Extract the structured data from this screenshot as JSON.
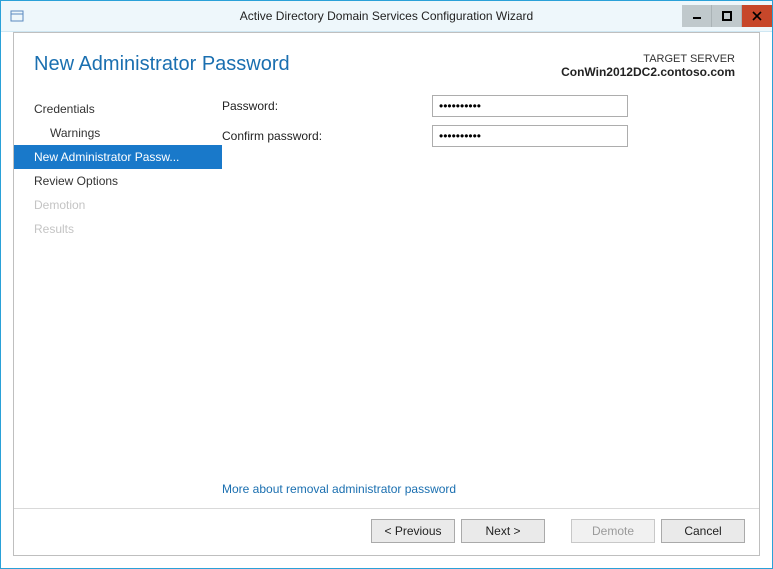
{
  "window": {
    "title": "Active Directory Domain Services Configuration Wizard"
  },
  "header": {
    "page_title": "New Administrator Password",
    "target_label": "TARGET SERVER",
    "target_server": "ConWin2012DC2.contoso.com"
  },
  "sidebar": {
    "steps": [
      {
        "label": "Credentials",
        "sub": false,
        "selected": false,
        "disabled": false
      },
      {
        "label": "Warnings",
        "sub": true,
        "selected": false,
        "disabled": false
      },
      {
        "label": "New Administrator Passw...",
        "sub": false,
        "selected": true,
        "disabled": false
      },
      {
        "label": "Review Options",
        "sub": false,
        "selected": false,
        "disabled": false
      },
      {
        "label": "Demotion",
        "sub": false,
        "selected": false,
        "disabled": true
      },
      {
        "label": "Results",
        "sub": false,
        "selected": false,
        "disabled": true
      }
    ]
  },
  "form": {
    "password_label": "Password:",
    "confirm_label": "Confirm password:",
    "password_value": "••••••••••",
    "confirm_value": "••••••••••"
  },
  "help_link": "More about removal administrator password",
  "footer": {
    "previous": "< Previous",
    "next": "Next >",
    "demote": "Demote",
    "cancel": "Cancel"
  }
}
